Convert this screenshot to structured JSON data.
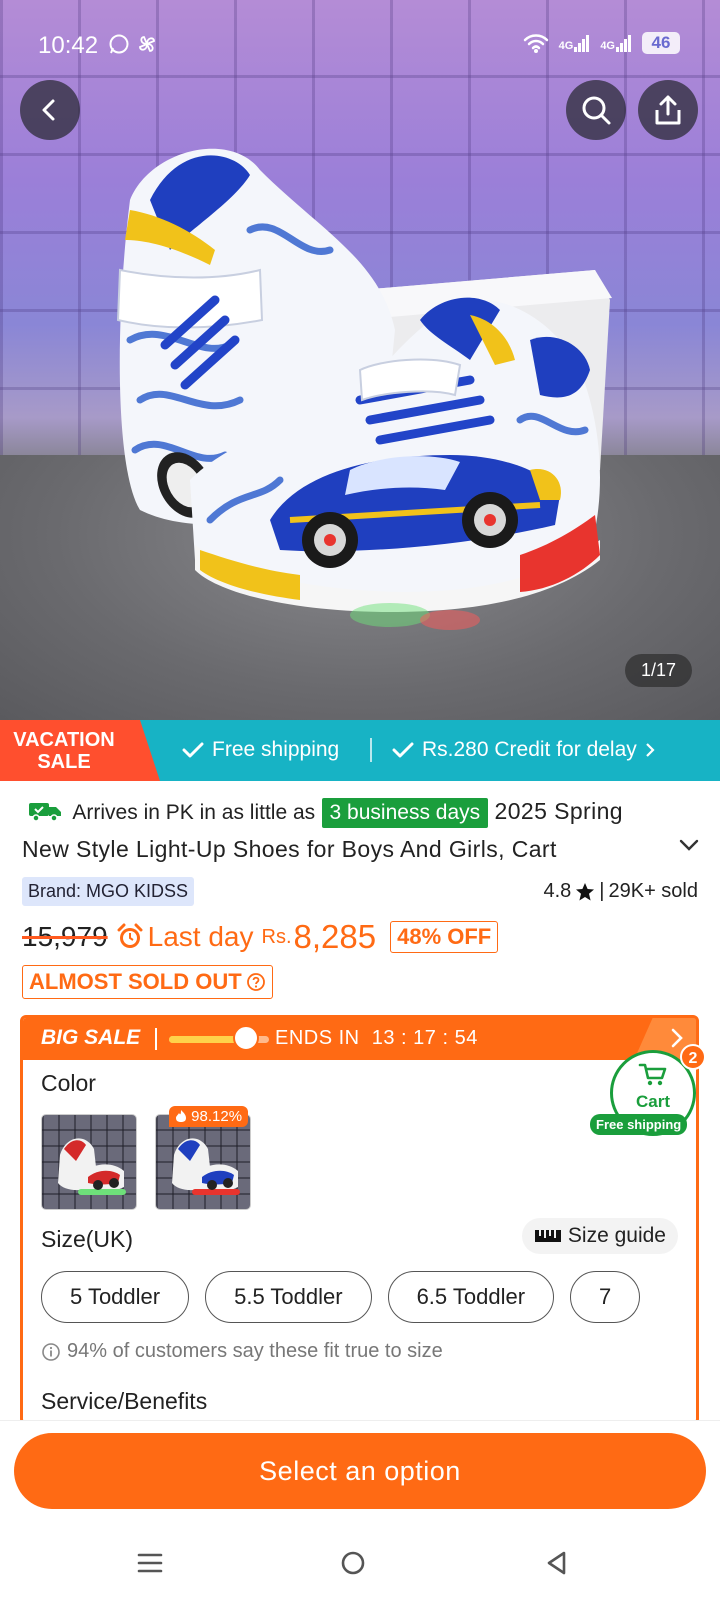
{
  "status_bar": {
    "time": "10:42",
    "network_1": "4G",
    "network_2": "4G",
    "battery": "46"
  },
  "hero": {
    "image_counter": "1/17"
  },
  "promo_bar": {
    "vacation_line1": "VACATION",
    "vacation_line2": "SALE",
    "free_shipping": "Free shipping",
    "credit": "Rs.280 Credit for delay"
  },
  "product": {
    "arrives_text": "Arrives in PK in as little as",
    "days_badge": "3 business days",
    "title": "2025 Spring New Style Light-Up Shoes for Boys And Girls, Cart",
    "brand": "Brand: MGO KIDSS",
    "rating": "4.8",
    "sold": "29K+ sold"
  },
  "pricing": {
    "old_price": "15,979",
    "last_day": "Last day",
    "currency": "Rs.",
    "price": "8,285",
    "discount": "48% OFF",
    "sold_out_badge": "ALMOST SOLD OUT"
  },
  "sale": {
    "title": "BIG SALE",
    "progress": 0.7,
    "ends_label": "ENDS IN",
    "countdown": "13 : 17 : 54"
  },
  "options": {
    "color_label": "Color",
    "swatch_badge": "98.12%",
    "size_label": "Size(UK)",
    "size_guide": "Size guide",
    "sizes": [
      "5 Toddler",
      "5.5 Toddler",
      "6.5 Toddler",
      "7"
    ],
    "fit_note": "94% of customers say these fit true to size",
    "service_label": "Service/Benefits"
  },
  "cart": {
    "label": "Cart",
    "count": "2",
    "free_shipping": "Free shipping"
  },
  "cta": {
    "select_option": "Select an option"
  },
  "colors": {
    "accent": "#ff6a14",
    "promo": "#17b3c5",
    "green": "#1a9e3c",
    "vacation": "#ff4f2e"
  }
}
